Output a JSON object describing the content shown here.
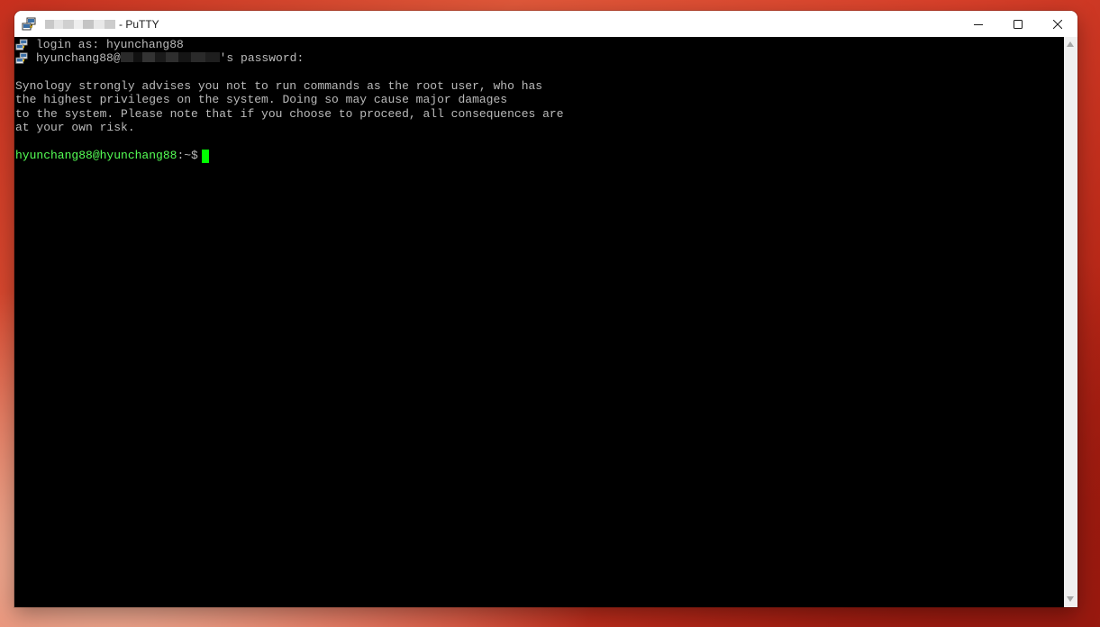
{
  "window": {
    "title_suffix": "- PuTTY"
  },
  "terminal": {
    "login_line": "login as: hyunchang88",
    "password_prefix": "hyunchang88@",
    "password_suffix": "'s password:",
    "warning_lines": [
      "Synology strongly advises you not to run commands as the root user, who has",
      "the highest privileges on the system. Doing so may cause major damages",
      "to the system. Please note that if you choose to proceed, all consequences are",
      "at your own risk."
    ],
    "prompt_user_host": "hyunchang88@hyunchang88",
    "prompt_path": ":~$ "
  },
  "colors": {
    "terminal_bg": "#000000",
    "terminal_text": "#bbbbbb",
    "prompt_green": "#55ff55",
    "cursor": "#00ff00"
  },
  "icons": {
    "app": "putty-icon",
    "minimize": "minimize-icon",
    "maximize": "maximize-icon",
    "close": "close-icon"
  }
}
